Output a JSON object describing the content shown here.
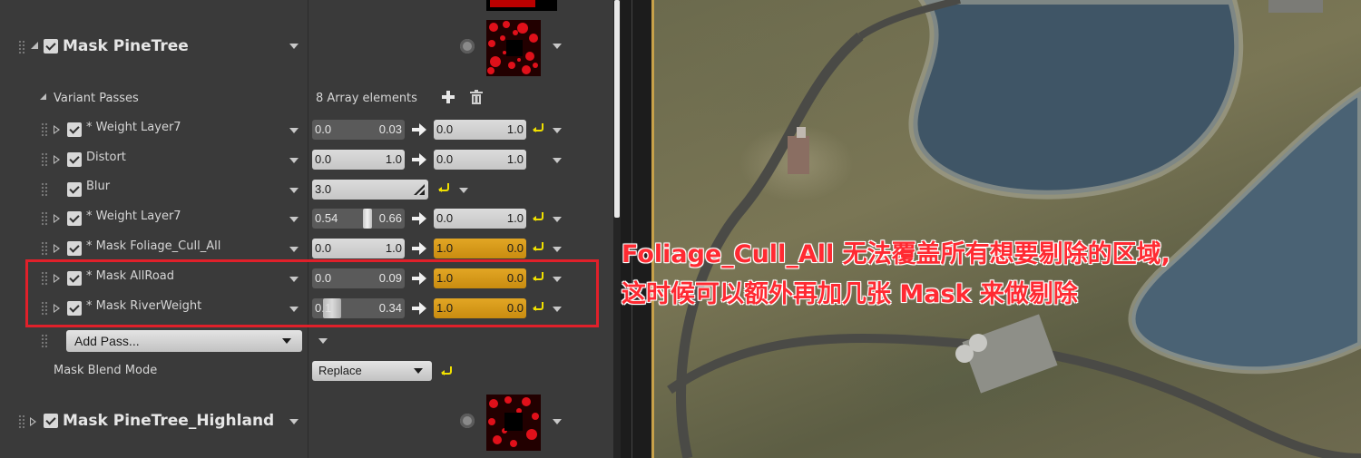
{
  "layers": {
    "pinetree": {
      "label": "Mask PineTree"
    },
    "highland": {
      "label": "Mask PineTree_Highland"
    }
  },
  "variant_passes": {
    "label": "Variant Passes",
    "count": "8 Array elements",
    "add_icon": "plus-icon",
    "delete_icon": "trash-icon"
  },
  "passes": [
    {
      "label": "* Weight Layer7",
      "min": "0.0",
      "max": "0.03",
      "out_min": "0.0",
      "out_max": "1.0",
      "out_style": "gray",
      "has_reset": true
    },
    {
      "label": "Distort",
      "min": "0.0",
      "max": "1.0",
      "out_min": "0.0",
      "out_max": "1.0",
      "out_style": "gray",
      "has_reset": false
    },
    {
      "label": "Blur",
      "value": "3.0"
    },
    {
      "label": "* Weight Layer7",
      "min": "0.54",
      "max": "0.66",
      "out_min": "0.0",
      "out_max": "1.0",
      "out_style": "gray",
      "has_reset": true
    },
    {
      "label": "* Mask Foliage_Cull_All",
      "min": "0.0",
      "max": "1.0",
      "out_min": "1.0",
      "out_max": "0.0",
      "out_style": "gold",
      "has_reset": true
    },
    {
      "label": "* Mask AllRoad",
      "min": "0.0",
      "max": "0.09",
      "out_min": "1.0",
      "out_max": "0.0",
      "out_style": "gold",
      "has_reset": true
    },
    {
      "label": "* Mask RiverWeight",
      "min": "0.1",
      "max": "0.34",
      "out_min": "1.0",
      "out_max": "0.0",
      "out_style": "gold",
      "has_reset": true
    }
  ],
  "add_pass": {
    "label": "Add Pass..."
  },
  "blend_mode": {
    "label": "Mask Blend Mode",
    "value": "Replace"
  },
  "annotation": {
    "line1": "Foliage_Cull_All 无法覆盖所有想要剔除的区域,",
    "line2": "这时候可以额外再加几张 Mask 来做剔除"
  },
  "colors": {
    "highlight": "#e0202a",
    "annotation": "#ff2a32",
    "gold_field": "#d99a18"
  }
}
